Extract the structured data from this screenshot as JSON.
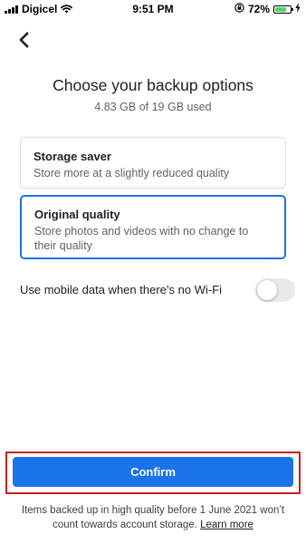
{
  "status_bar": {
    "carrier": "Digicel",
    "time": "9:51 PM",
    "battery_percent": "72%",
    "battery_level": 0.72,
    "icons": [
      "signal-icon",
      "wifi-icon",
      "orientation-lock-icon",
      "battery-icon",
      "charging-icon"
    ]
  },
  "header": {
    "back_icon": "chevron-left-icon",
    "title": "Choose your backup options",
    "storage_usage": "4.83 GB of 19 GB used"
  },
  "options": [
    {
      "title": "Storage saver",
      "description": "Store more at a slightly reduced quality",
      "selected": false
    },
    {
      "title": "Original quality",
      "description": "Store photos and videos with no change to their quality",
      "selected": true
    }
  ],
  "mobile_data": {
    "label": "Use mobile data when there’s no Wi-Fi",
    "enabled": false
  },
  "confirm": {
    "label": "Confirm"
  },
  "footer": {
    "note": "Items backed up in high quality before 1 June 2021 won’t count towards account storage.",
    "learn_more": "Learn more"
  },
  "colors": {
    "accent": "#1a73e8",
    "highlight_outline": "#cc1f1f",
    "toggle_off": "#e9e9ea",
    "battery_fill": "#4cd964"
  }
}
